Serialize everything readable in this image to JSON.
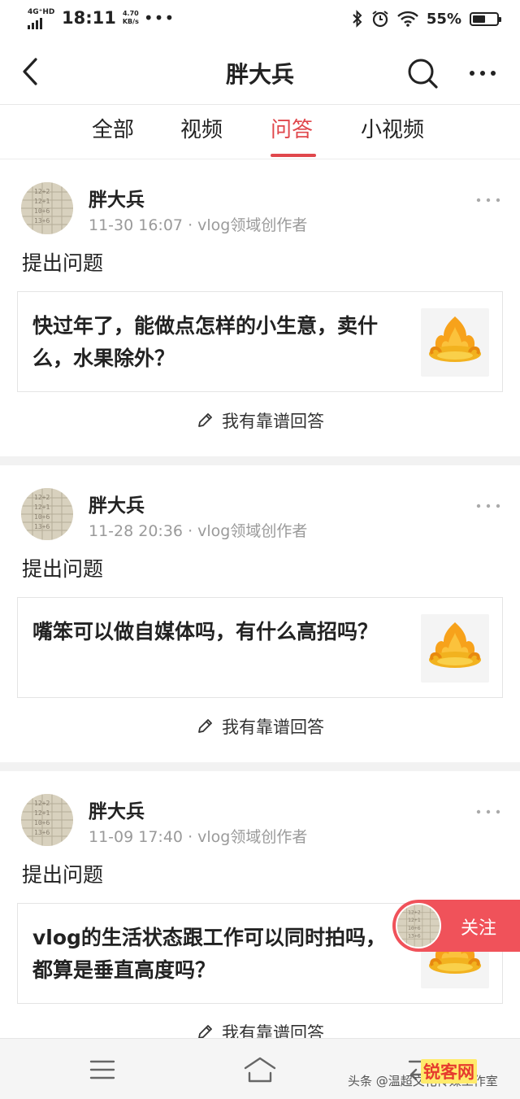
{
  "status_bar": {
    "network": "4G⁺HD",
    "time": "18:11",
    "speed_value": "4.70",
    "speed_unit": "KB/s",
    "more": "•••",
    "battery_text": "55%",
    "battery_level_percent": 55
  },
  "header": {
    "title": "胖大兵",
    "back_icon": "chevron-left-icon",
    "search_icon": "search-icon",
    "more_icon": "more-horizontal-icon"
  },
  "tabs": [
    {
      "label": "全部",
      "active": false
    },
    {
      "label": "视频",
      "active": false
    },
    {
      "label": "问答",
      "active": true
    },
    {
      "label": "小视频",
      "active": false
    }
  ],
  "posts": [
    {
      "author": "胖大兵",
      "date": "11-30 16:07",
      "separator": "·",
      "role": "vlog领域创作者",
      "action": "提出问题",
      "question": "快过年了，能做点怎样的小生意，卖什么，水果除外？",
      "answer_label": "我有靠谱回答"
    },
    {
      "author": "胖大兵",
      "date": "11-28 20:36",
      "separator": "·",
      "role": "vlog领域创作者",
      "action": "提出问题",
      "question": "嘴笨可以做自媒体吗，有什么高招吗？",
      "answer_label": "我有靠谱回答"
    },
    {
      "author": "胖大兵",
      "date": "11-09 17:40",
      "separator": "·",
      "role": "vlog领域创作者",
      "action": "提出问题",
      "question": "vlog的生活状态跟工作可以同时拍吗，都算是垂直高度吗？",
      "answer_label": "我有靠谱回答"
    }
  ],
  "follow_button": {
    "label": "关注"
  },
  "watermark": {
    "text": "头条 @温超文化传媒工作室",
    "logo": "锐客网"
  },
  "colors": {
    "accent": "#e0474c",
    "follow_bg": "#f0525a",
    "meta_text": "#9a9a9a"
  }
}
